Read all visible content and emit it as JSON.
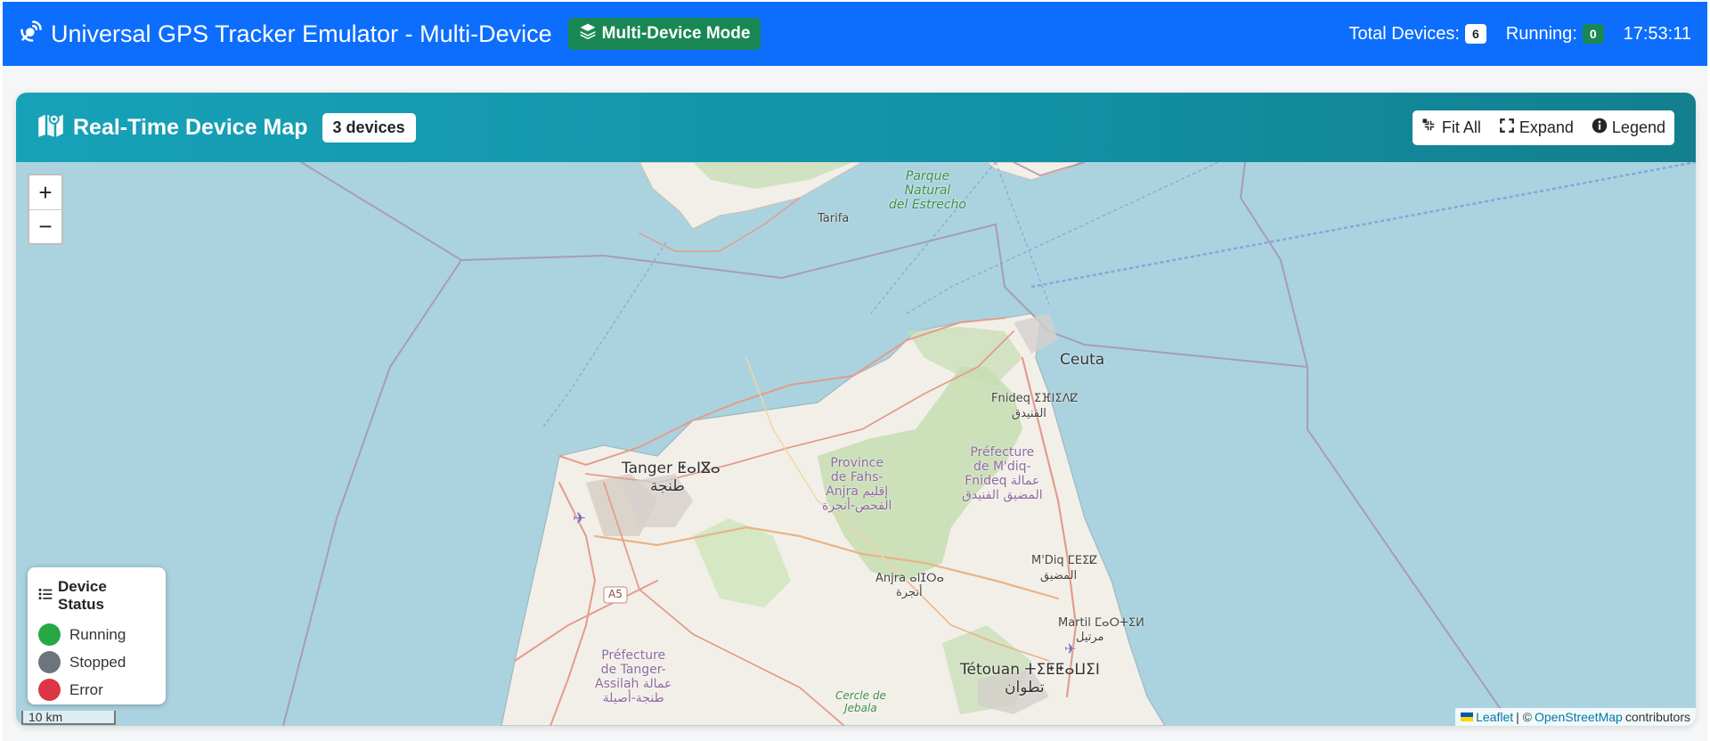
{
  "navbar": {
    "title": "Universal GPS Tracker Emulator - Multi-Device",
    "mode_badge": "Multi-Device Mode",
    "total_label": "Total Devices:",
    "total_count": "6",
    "running_label": "Running:",
    "running_count": "0",
    "clock": "17:53:11"
  },
  "map_card": {
    "title": "Real-Time Device Map",
    "devices_badge": "3 devices",
    "buttons": {
      "fit_all": "Fit All",
      "expand": "Expand",
      "legend": "Legend"
    }
  },
  "zoom": {
    "in": "+",
    "out": "−"
  },
  "legend": {
    "title": "Device Status",
    "items": [
      {
        "label": "Running",
        "color": "#28a745"
      },
      {
        "label": "Stopped",
        "color": "#6c757d"
      },
      {
        "label": "Error",
        "color": "#dc3545"
      }
    ]
  },
  "scale": "10 km",
  "attribution": {
    "leaflet": "Leaflet",
    "separator": "| ©",
    "osm": "OpenStreetMap",
    "suffix": "contributors"
  },
  "places": {
    "tarifa": "Tarifa",
    "parque": "Parque\nNatural\ndel Estrecho",
    "ceuta": "Ceuta",
    "fnideq": "Fnideq ⵉⴼⵏⵉⴷⵇ",
    "fnideq_ar": "الفنيدق",
    "tanger": "Tanger ⵟⴰⵏⴵⴰ",
    "tanger_ar": "طنجة",
    "fahs": "Province\nde Fahs-\nAnjra إقليم\nالفحص-أنجرة",
    "mdiq_pref": "Préfecture\nde M'diq-\nFnideq عمالة\nالمضيق الفنيدق",
    "mdiq": "M'Diq ⵎⴹⵉⵇ",
    "mdiq_ar": "المضيق",
    "anjra": "Anjra ⴰⵏⵊⵔⴰ",
    "anjra_ar": "أنجرة",
    "a5": "A5",
    "martil": "Martil ⵎⴰⵔⵜⵉⵍ",
    "martil_ar": "مرتيل",
    "tanger_pref": "Préfecture\nde Tanger-\nAssilah عمالة\nطنجة-أصيلة",
    "tetouan": "Tétouan ⵜⵉⵟⵟⴰⵡⵉⵏ",
    "tetouan_ar": "تطوان",
    "jebala": "Cercle de\nJebala"
  },
  "colors": {
    "navbar": "#0d6efd",
    "badge_green": "#198754",
    "card_header": "#17a2b8",
    "sea": "#aad3df",
    "land": "#f2efe9"
  }
}
